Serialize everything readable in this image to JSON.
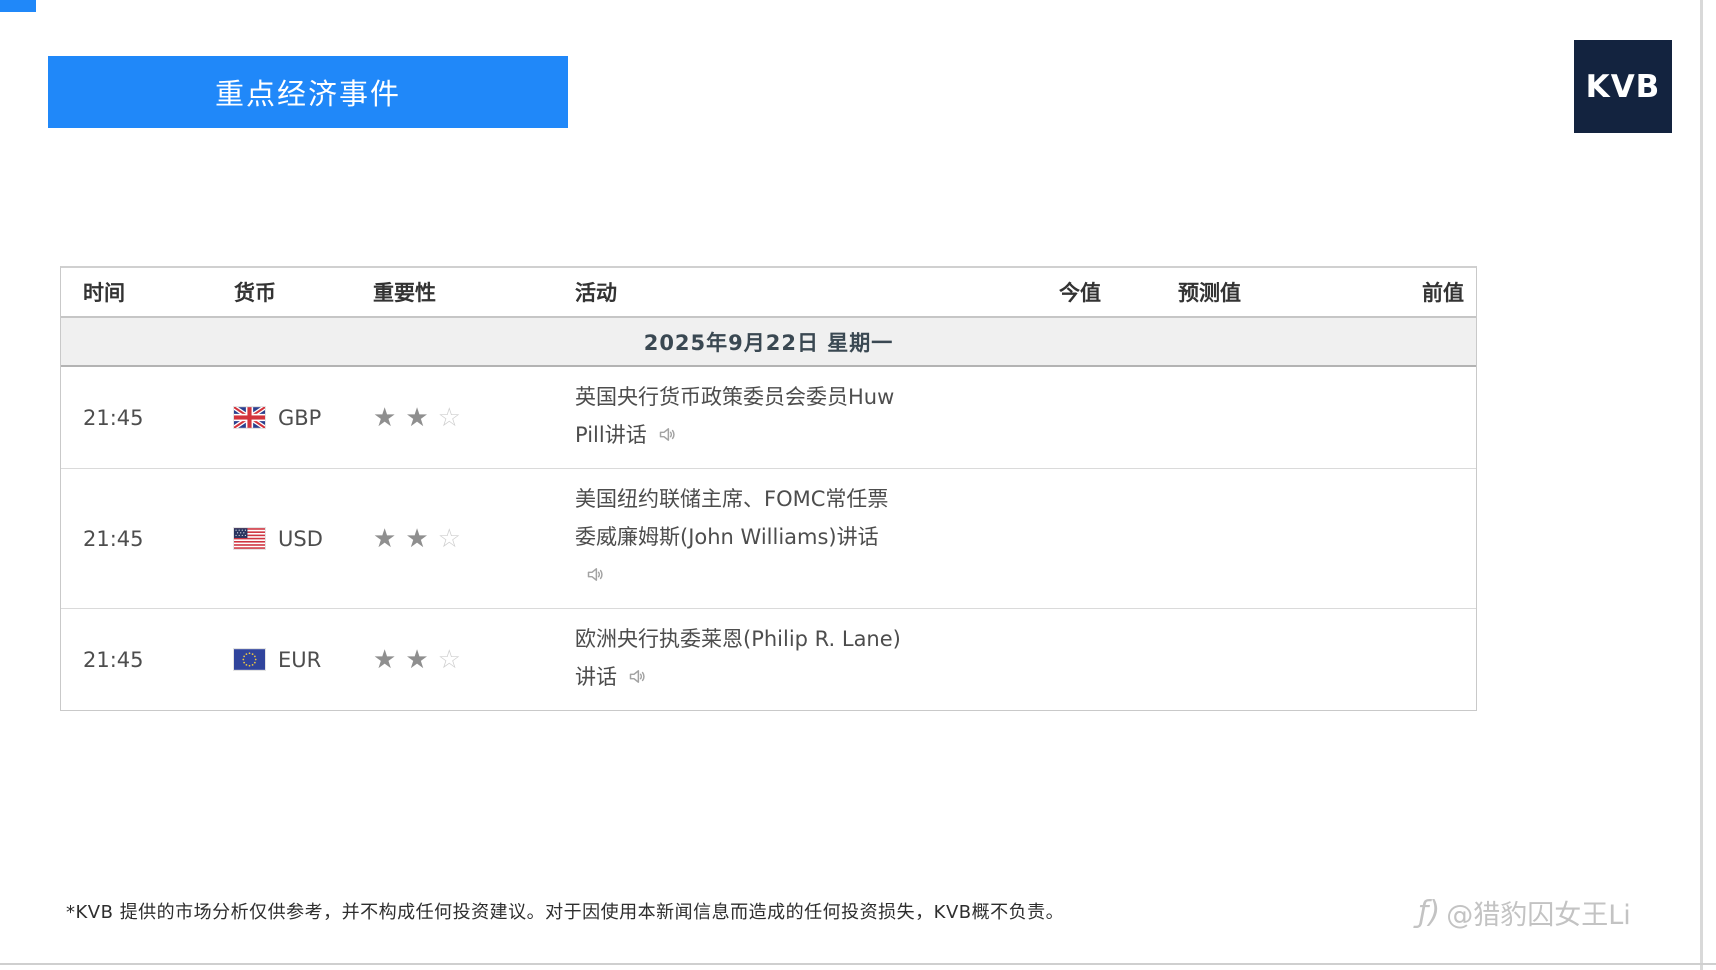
{
  "page": {
    "banner_title": "重点经济事件",
    "logo_text": "KVB"
  },
  "colors": {
    "accent_blue": "#2088f9",
    "logo_navy": "#13233f",
    "date_row_bg": "#f0f0f0",
    "star_filled": "#8f8f8f",
    "star_empty": "#cfcfcf"
  },
  "table": {
    "columns": [
      {
        "label": "时间"
      },
      {
        "label": "货币"
      },
      {
        "label": "重要性"
      },
      {
        "label": "活动"
      },
      {
        "label": "今值"
      },
      {
        "label": "预测值"
      },
      {
        "label": "前值"
      }
    ],
    "date_header": "2025年9月22日  星期一",
    "rows": [
      {
        "time": "21:45",
        "flag": "gb",
        "flag_icon": "uk-flag-icon",
        "currency": "GBP",
        "importance": 2,
        "importance_max": 3,
        "activity_lines": [
          "英国央行货币政策委员会委员Huw",
          "Pill讲话"
        ],
        "has_audio": true,
        "actual": "",
        "forecast": "",
        "previous": ""
      },
      {
        "time": "21:45",
        "flag": "us",
        "flag_icon": "us-flag-icon",
        "currency": "USD",
        "importance": 2,
        "importance_max": 3,
        "activity_lines": [
          "美国纽约联储主席、FOMC常任票",
          "委威廉姆斯(John Williams)讲话",
          ""
        ],
        "has_audio": true,
        "actual": "",
        "forecast": "",
        "previous": ""
      },
      {
        "time": "21:45",
        "flag": "eu",
        "flag_icon": "eu-flag-icon",
        "currency": "EUR",
        "importance": 2,
        "importance_max": 3,
        "activity_lines": [
          "欧洲央行执委莱恩(Philip R. Lane)",
          "讲话"
        ],
        "has_audio": true,
        "actual": "",
        "forecast": "",
        "previous": ""
      }
    ]
  },
  "footer": {
    "disclaimer": "*KVB 提供的市场分析仅供参考，并不构成任何投资建议。对于因使用本新闻信息而造成的任何投资损失，KVB概不负责。"
  },
  "watermark": {
    "icon": "signature-icon",
    "text": "@猎豹囚女王Li"
  }
}
